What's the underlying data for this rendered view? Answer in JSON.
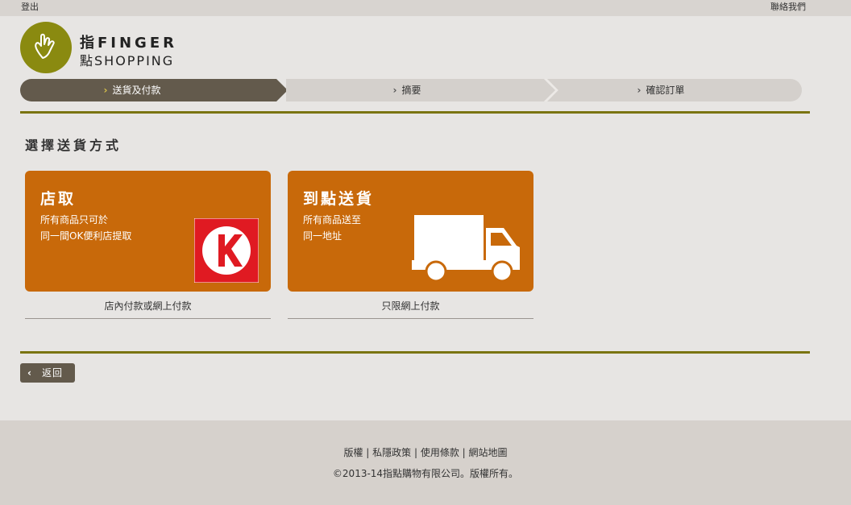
{
  "topbar": {
    "logout": "登出",
    "contact": "聯絡我們"
  },
  "logo": {
    "line1": "指FINGER",
    "line2": "點SHOPPING"
  },
  "steps": [
    {
      "label": "送貨及付款",
      "active": true
    },
    {
      "label": "摘要",
      "active": false
    },
    {
      "label": "確認訂單",
      "active": false
    }
  ],
  "step_chevron": "›",
  "section_title": "選擇送貨方式",
  "options": [
    {
      "title": "店取",
      "desc_line1": "所有商品只可於",
      "desc_line2": "同一間OK便利店提取",
      "note": "店內付款或網上付款",
      "icon": "circle-k-logo"
    },
    {
      "title": "到點送貨",
      "desc_line1": "所有商品送至",
      "desc_line2": "同一地址",
      "note": "只限網上付款",
      "icon": "truck-icon"
    }
  ],
  "back_button": {
    "label": "返回",
    "icon": "chevron-left-icon"
  },
  "footer": {
    "links": [
      "版權",
      "私隱政策",
      "使用條款",
      "網站地圖"
    ],
    "separator": " | ",
    "copyright": "©2013-14指點購物有限公司。版權所有。"
  },
  "colors": {
    "accent_orange": "#c8690a",
    "dark_brown": "#635a4c",
    "olive_line": "#7a7411",
    "logo_green": "#8a8a10"
  }
}
